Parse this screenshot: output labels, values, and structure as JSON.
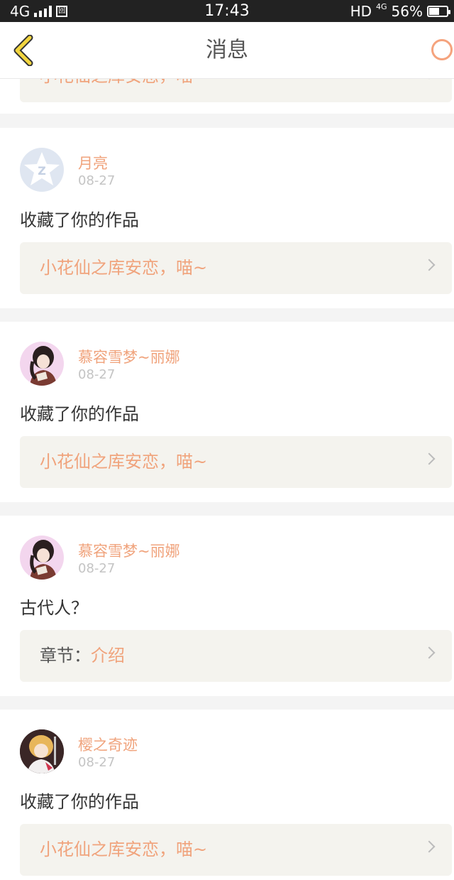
{
  "status_bar": {
    "network": "4G",
    "box_glyph": "回",
    "time": "17:43",
    "hd": "HD",
    "network_small": "4G",
    "battery": "56%"
  },
  "navbar": {
    "back_icon": "chevron-left-icon",
    "title": "消息",
    "refresh_icon": "refresh-icon"
  },
  "cards": [
    {
      "link_text": "小花仙之库安恋，喵~"
    },
    {
      "avatar": "qq-default-avatar",
      "username": "月亮",
      "date": "08-27",
      "message": "收藏了你的作品",
      "link_text": "小花仙之库安恋，喵~"
    },
    {
      "avatar": "anime-girl-avatar",
      "username": "慕容雪梦~丽娜",
      "date": "08-27",
      "message": "收藏了你的作品",
      "link_text": "小花仙之库安恋，喵~"
    },
    {
      "avatar": "anime-girl-avatar",
      "username": "慕容雪梦~丽娜",
      "date": "08-27",
      "message": "古代人？",
      "link_prefix": "章节：",
      "link_text": "介绍"
    },
    {
      "avatar": "anime-blonde-avatar",
      "username": "樱之奇迹",
      "date": "08-27",
      "message": "收藏了你的作品",
      "link_text": "小花仙之库安恋，喵~"
    }
  ],
  "colors": {
    "accent": "#f0a37c",
    "card_link_bg": "#f4f3ee",
    "status_bar": "#222222"
  }
}
